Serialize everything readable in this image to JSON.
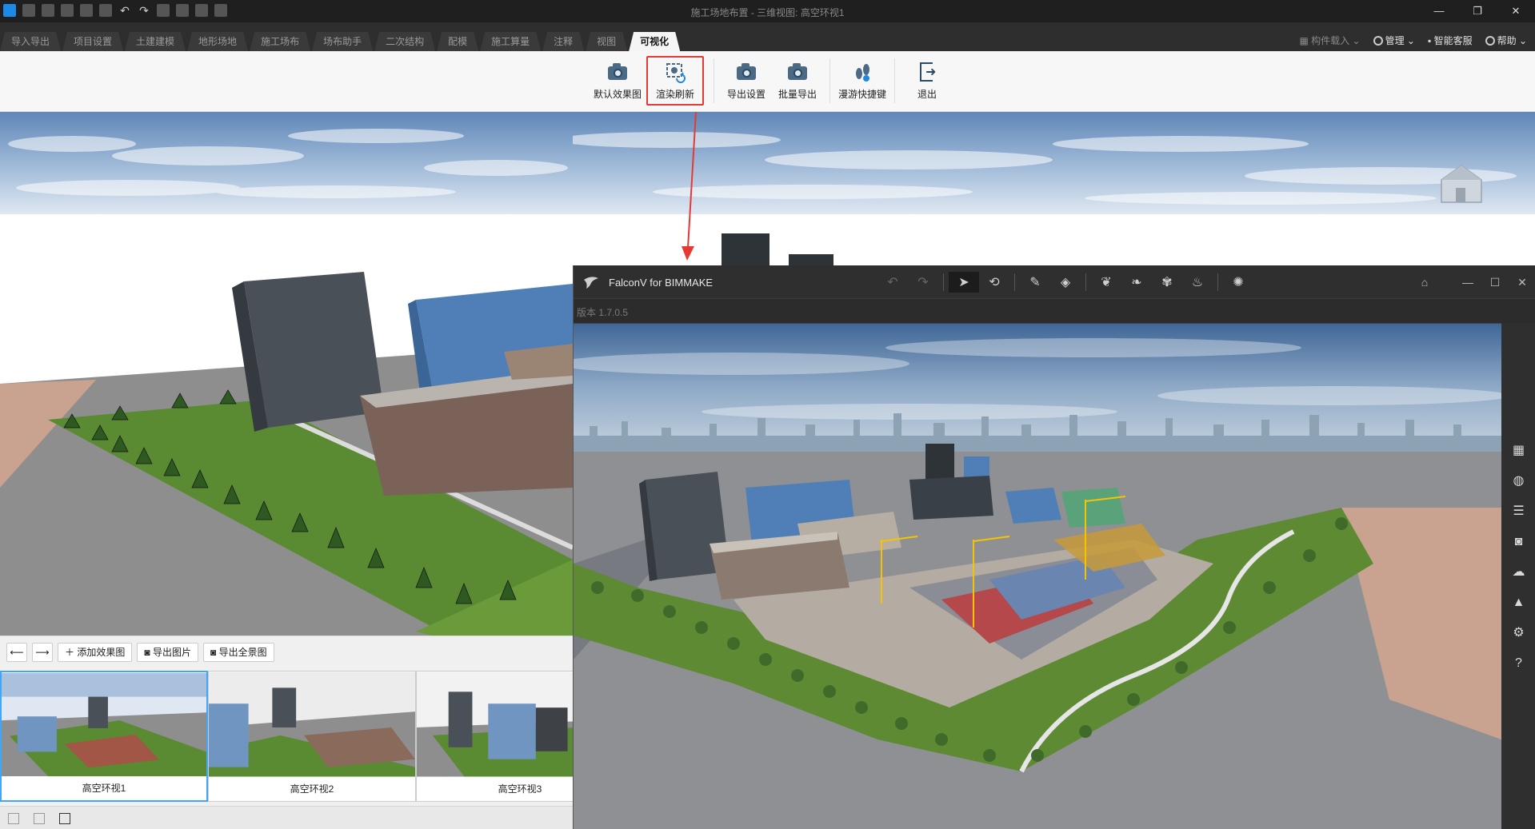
{
  "window": {
    "title": "施工场地布置 - 三维视图: 高空环视1"
  },
  "ribbon_tabs": [
    {
      "label": "导入导出"
    },
    {
      "label": "项目设置"
    },
    {
      "label": "土建建模"
    },
    {
      "label": "地形场地"
    },
    {
      "label": "施工场布"
    },
    {
      "label": "场布助手"
    },
    {
      "label": "二次结构"
    },
    {
      "label": "配模"
    },
    {
      "label": "施工算量"
    },
    {
      "label": "注释"
    },
    {
      "label": "视图"
    },
    {
      "label": "可视化"
    }
  ],
  "header_right": {
    "component_load": "构件载入",
    "manage": "管理",
    "support": "智能客服",
    "help": "帮助"
  },
  "ribbon_tools": {
    "default_render": "默认效果图",
    "render_refresh": "渲染刷新",
    "export_settings": "导出设置",
    "batch_export": "批量导出",
    "walk_shortcuts": "漫游快捷键",
    "exit": "退出"
  },
  "bottom_panel": {
    "add_render": "添加效果图",
    "export_image": "导出图片",
    "export_panorama": "导出全景图",
    "thumbnails": [
      {
        "label": "高空环视1"
      },
      {
        "label": "高空环视2"
      },
      {
        "label": "高空环视3"
      }
    ]
  },
  "falcon": {
    "title": "FalconV for BIMMAKE",
    "version": "版本 1.7.0.5"
  },
  "colors": {
    "highlight_red": "#e53935",
    "selected_blue": "#42a5f5",
    "grass": "#5a8a32",
    "dark_chrome": "#2f2f2f"
  }
}
